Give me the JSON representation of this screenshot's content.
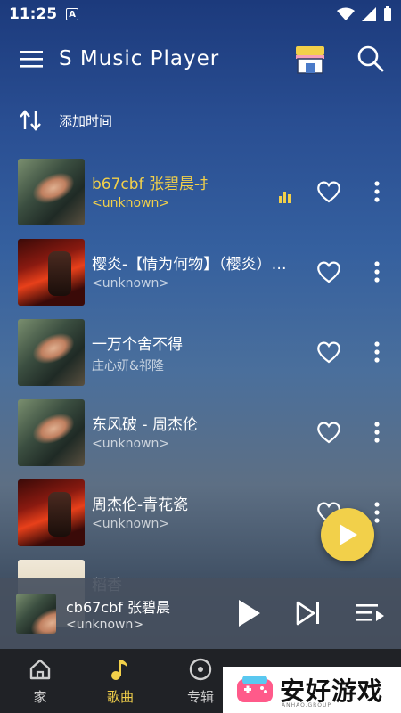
{
  "status_bar": {
    "time": "11:25",
    "notification_letter": "A"
  },
  "app_bar": {
    "title": "S Music Player"
  },
  "sort": {
    "label": "添加时间"
  },
  "songs": [
    {
      "title": "b67cbf              张碧晨-扌",
      "artist": "<unknown>",
      "art": "guitar",
      "playing": true
    },
    {
      "title": "樱炎-【情为何物】（樱炎）…",
      "artist": "<unknown>",
      "art": "red",
      "playing": false
    },
    {
      "title": "一万个舍不得",
      "artist": "庄心妍&祁隆",
      "art": "guitar",
      "playing": false
    },
    {
      "title": "东风破 - 周杰伦",
      "artist": "<unknown>",
      "art": "guitar",
      "playing": false
    },
    {
      "title": "周杰伦-青花瓷",
      "artist": "<unknown>",
      "art": "red",
      "playing": false
    },
    {
      "title": "稻香",
      "artist": "",
      "art": "light",
      "playing": false
    }
  ],
  "mini_player": {
    "title": "cb67cbf              张碧晨",
    "artist": "<unknown>"
  },
  "nav": [
    {
      "label": "家",
      "icon": "home-icon",
      "active": false
    },
    {
      "label": "歌曲",
      "icon": "music-note-icon",
      "active": true
    },
    {
      "label": "专辑",
      "icon": "album-icon",
      "active": false
    },
    {
      "label": "",
      "icon": "artist-icon",
      "active": false
    },
    {
      "label": "",
      "icon": "folder-icon",
      "active": false
    }
  ],
  "watermark": {
    "text": "安好游戏",
    "sub": "ANHAO.GROUP"
  },
  "colors": {
    "accent": "#f2d04a",
    "nav_bg": "#202226"
  }
}
